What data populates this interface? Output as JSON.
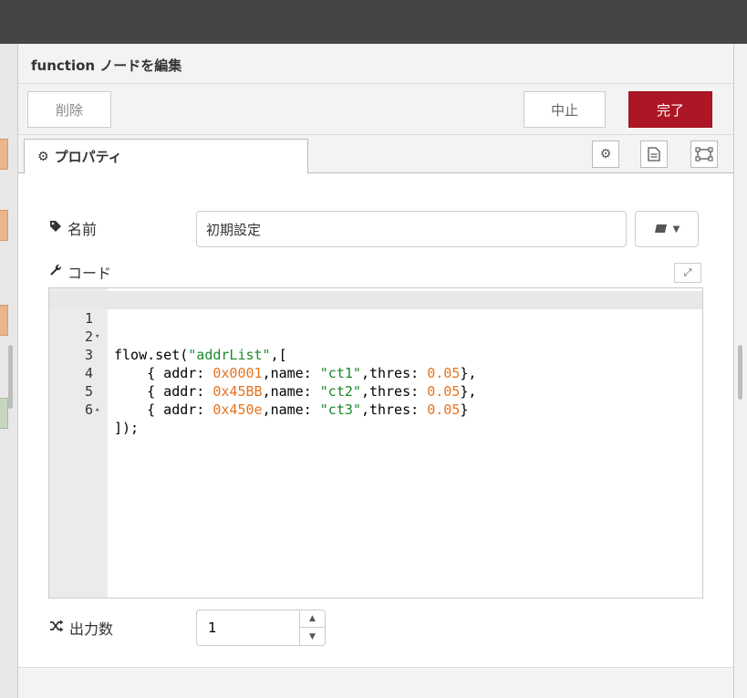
{
  "dialog": {
    "title": "function ノードを編集"
  },
  "toolbar": {
    "delete_label": "削除",
    "cancel_label": "中止",
    "done_label": "完了"
  },
  "tabs": {
    "properties_label": "プロパティ"
  },
  "form": {
    "name_label": "名前",
    "name_value": "初期設定",
    "code_label": "コード",
    "outputs_label": "出力数",
    "outputs_value": "1"
  },
  "code": {
    "lines": [
      {
        "number": "1",
        "fold": "▾",
        "text": "flow.set(\"addrList\",["
      },
      {
        "number": "2",
        "fold": "",
        "text": "    { addr: 0x0001,name: \"ct1\",thres: 0.05},"
      },
      {
        "number": "3",
        "fold": "",
        "text": "    { addr: 0x45BB,name: \"ct2\",thres: 0.05},"
      },
      {
        "number": "4",
        "fold": "",
        "text": "    { addr: 0x450e,name: \"ct3\",thres: 0.05}"
      },
      {
        "number": "5",
        "fold": "▴",
        "text": "]);"
      },
      {
        "number": "6",
        "fold": "",
        "text": ""
      }
    ]
  },
  "icons": {
    "gear": "gear-icon",
    "tag": "tag-icon",
    "wrench": "wrench-icon",
    "shuffle": "shuffle-icon",
    "document": "document-icon",
    "frame": "frame-icon",
    "book": "book-icon",
    "expand": "expand-icon"
  },
  "colors": {
    "done_button": "#ad1625",
    "string_token": "#1a8a2a",
    "number_token": "#e8731e",
    "topbar": "#454545"
  }
}
